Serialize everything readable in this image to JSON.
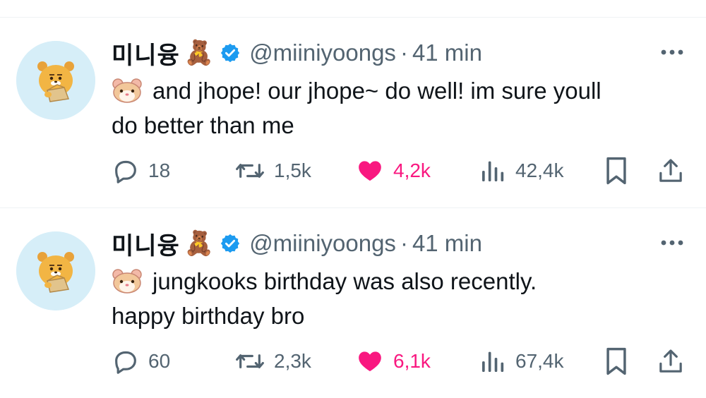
{
  "colors": {
    "text_primary": "#0f1419",
    "text_secondary": "#536471",
    "verified_blue": "#1d9bf0",
    "like_pink": "#f91880",
    "divider": "#eff3f4",
    "avatar_bg": "#d6eef8"
  },
  "tweets": [
    {
      "author": {
        "display_name": "미니융",
        "name_emoji": "🧸",
        "handle": "@miiniyoongs",
        "verified": true
      },
      "dot": "·",
      "time": "41 min",
      "emoji": "🐹",
      "line1": "and jhope! our jhope~ do well! im sure youll",
      "line2": "do better than me",
      "stats": {
        "replies": "18",
        "reposts": "1,5k",
        "likes": "4,2k",
        "views": "42,4k"
      },
      "liked": true
    },
    {
      "author": {
        "display_name": "미니융",
        "name_emoji": "🧸",
        "handle": "@miiniyoongs",
        "verified": true
      },
      "dot": "·",
      "time": "41 min",
      "emoji": "🐹",
      "line1": "jungkooks birthday was also recently.",
      "line2": "happy birthday bro",
      "stats": {
        "replies": "60",
        "reposts": "2,3k",
        "likes": "6,1k",
        "views": "67,4k"
      },
      "liked": true
    }
  ],
  "icons": {
    "avatar": "ryan-character-avatar",
    "verified": "verified-badge-icon",
    "more": "more-options-icon",
    "reply": "reply-bubble-icon",
    "repost": "repost-arrows-icon",
    "like": "heart-icon",
    "views": "views-bars-icon",
    "bookmark": "bookmark-icon",
    "share": "share-upload-icon"
  }
}
